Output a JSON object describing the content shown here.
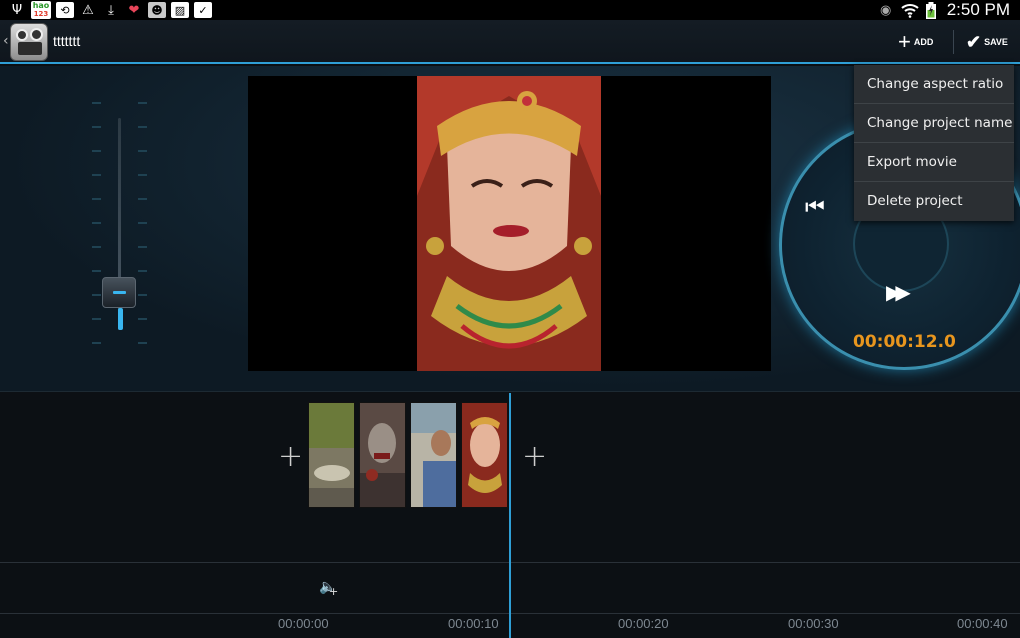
{
  "status_bar": {
    "time": "2:50 PM",
    "left_icons": [
      "usb-icon",
      "hao123-icon",
      "sync-icon",
      "warning-icon",
      "download-icon",
      "heart-app-icon",
      "zombie-app-icon",
      "image-icon",
      "bag-icon"
    ],
    "right_icons": [
      "eye-icon",
      "wifi-icon",
      "battery-icon"
    ],
    "hao_label": "hao",
    "hao_sub": "123"
  },
  "action_bar": {
    "project_name": "ttttttt",
    "add_label": "ADD",
    "save_label": "SAVE"
  },
  "menu": {
    "items": [
      {
        "label": "Change aspect ratio"
      },
      {
        "label": "Change project name"
      },
      {
        "label": "Export movie"
      },
      {
        "label": "Delete project"
      }
    ]
  },
  "player": {
    "timecode": "00:00:12.0",
    "volume_level": 0.1
  },
  "timeline": {
    "clips": [
      "clip-nature",
      "clip-zombie-1",
      "clip-man",
      "clip-bride"
    ],
    "ruler": [
      "00:00:00",
      "00:00:10",
      "00:00:20",
      "00:00:30",
      "00:00:40"
    ]
  },
  "colors": {
    "accent": "#2f9fd6",
    "timecode": "#e8961e",
    "background": "#0b0f13"
  }
}
